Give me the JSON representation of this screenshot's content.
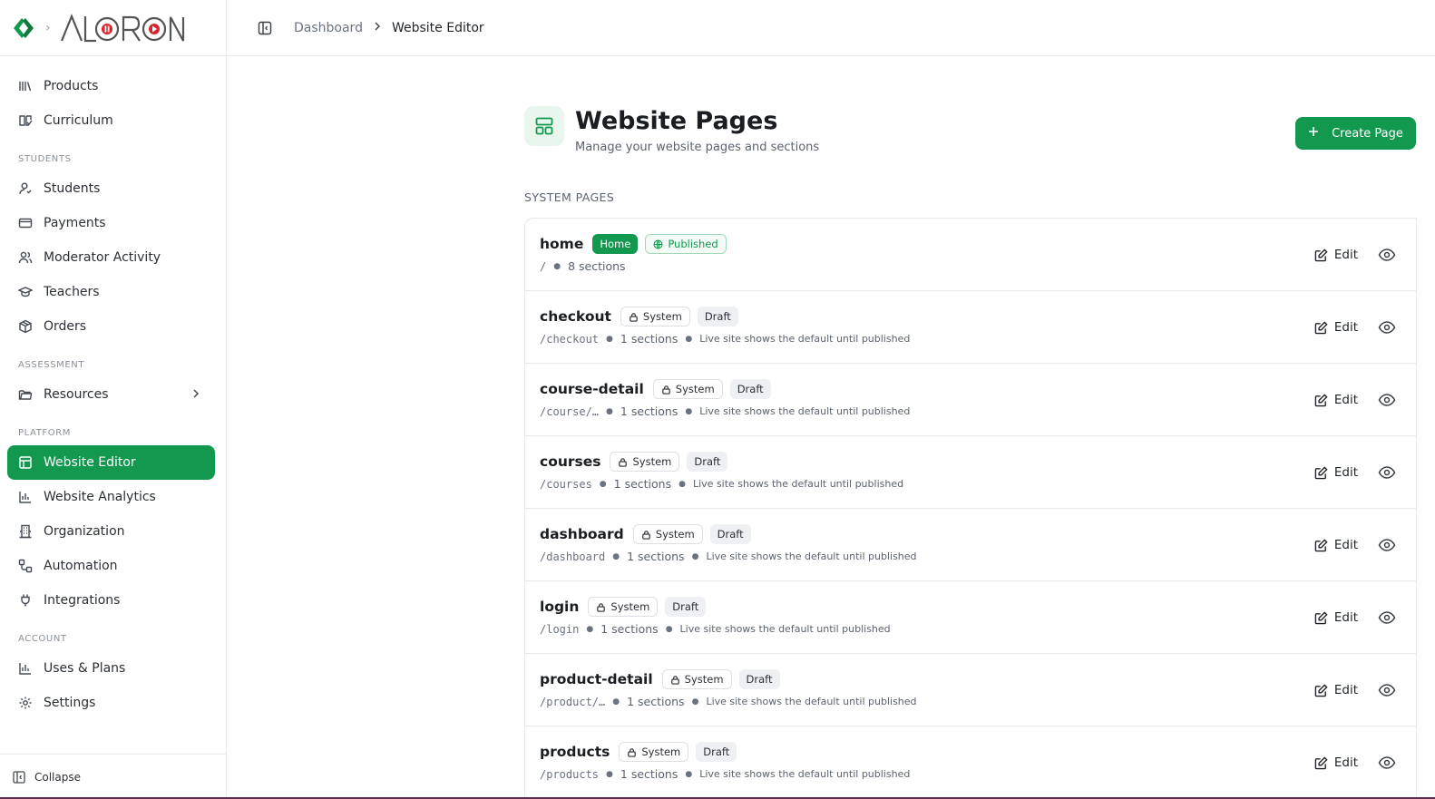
{
  "brand": {
    "name": "ALORON",
    "accent": "#13994f"
  },
  "topbar": {
    "crumbs": [
      "Dashboard",
      "Website Editor"
    ]
  },
  "sidebar": {
    "top_items": [
      {
        "label": "Products",
        "icon": "library-icon"
      },
      {
        "label": "Curriculum",
        "icon": "book-open-icon"
      }
    ],
    "sections": [
      {
        "title": "STUDENTS",
        "items": [
          {
            "label": "Students",
            "icon": "user-icon"
          },
          {
            "label": "Payments",
            "icon": "credit-card-icon"
          },
          {
            "label": "Moderator Activity",
            "icon": "users-icon"
          },
          {
            "label": "Teachers",
            "icon": "graduation-cap-icon"
          },
          {
            "label": "Orders",
            "icon": "package-icon"
          }
        ]
      },
      {
        "title": "ASSESSMENT",
        "items": [
          {
            "label": "Resources",
            "icon": "folder-icon"
          }
        ]
      },
      {
        "title": "PLATFORM",
        "items": [
          {
            "label": "Website Editor",
            "icon": "layout-icon"
          },
          {
            "label": "Website Analytics",
            "icon": "bar-chart-icon"
          },
          {
            "label": "Organization",
            "icon": "building-icon"
          },
          {
            "label": "Automation",
            "icon": "workflow-icon"
          },
          {
            "label": "Integrations",
            "icon": "plug-icon"
          }
        ]
      },
      {
        "title": "ACCOUNT",
        "items": [
          {
            "label": "Uses & Plans",
            "icon": "bar-chart-icon"
          },
          {
            "label": "Settings",
            "icon": "gear-icon"
          }
        ]
      }
    ],
    "collapse_label": "Collapse"
  },
  "main": {
    "title": "Website Pages",
    "subtitle": "Manage your website pages and sections",
    "create_label": "Create Page",
    "section_label": "SYSTEM PAGES",
    "edit_label": "Edit",
    "pages": [
      {
        "name": "home",
        "tags": [
          "Home",
          "Published"
        ],
        "path": "/",
        "sections": "8 sections",
        "note": ""
      },
      {
        "name": "checkout",
        "tags": [
          "System",
          "Draft"
        ],
        "path": "/checkout",
        "sections": "1 sections",
        "note": "Live site shows the default until published"
      },
      {
        "name": "course-detail",
        "tags": [
          "System",
          "Draft"
        ],
        "path": "/course/…",
        "sections": "1 sections",
        "note": "Live site shows the default until published"
      },
      {
        "name": "courses",
        "tags": [
          "System",
          "Draft"
        ],
        "path": "/courses",
        "sections": "1 sections",
        "note": "Live site shows the default until published"
      },
      {
        "name": "dashboard",
        "tags": [
          "System",
          "Draft"
        ],
        "path": "/dashboard",
        "sections": "1 sections",
        "note": "Live site shows the default until published"
      },
      {
        "name": "login",
        "tags": [
          "System",
          "Draft"
        ],
        "path": "/login",
        "sections": "1 sections",
        "note": "Live site shows the default until published"
      },
      {
        "name": "product-detail",
        "tags": [
          "System",
          "Draft"
        ],
        "path": "/product/…",
        "sections": "1 sections",
        "note": "Live site shows the default until published"
      },
      {
        "name": "products",
        "tags": [
          "System",
          "Draft"
        ],
        "path": "/products",
        "sections": "1 sections",
        "note": "Live site shows the default until published"
      }
    ]
  }
}
